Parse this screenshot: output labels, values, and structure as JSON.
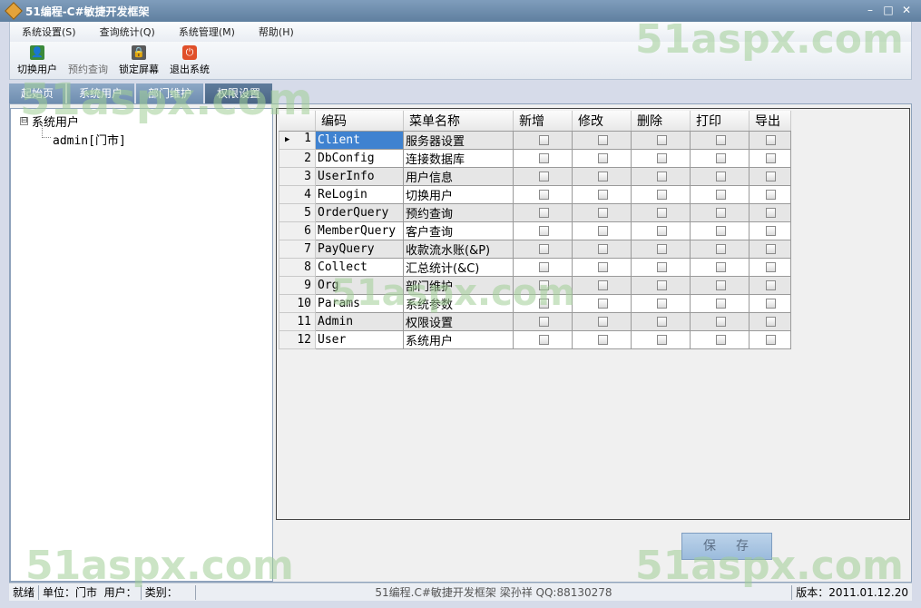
{
  "window": {
    "title": "51编程-C#敏捷开发框架"
  },
  "menu": [
    "系统设置(S)",
    "查询统计(Q)",
    "系统管理(M)",
    "帮助(H)"
  ],
  "toolbar": [
    {
      "label": "切换用户",
      "icon": "switch-user-icon",
      "enabled": true
    },
    {
      "label": "预约查询",
      "icon": "query-icon",
      "enabled": false
    },
    {
      "label": "锁定屏幕",
      "icon": "lock-icon",
      "enabled": true
    },
    {
      "label": "退出系统",
      "icon": "power-icon",
      "enabled": true
    }
  ],
  "tabs": [
    {
      "label": "起始页",
      "active": false
    },
    {
      "label": "系统用户",
      "active": false
    },
    {
      "label": "部门维护",
      "active": false
    },
    {
      "label": "权限设置",
      "active": true
    }
  ],
  "tree": {
    "root": "系统用户",
    "toggle": "⊟",
    "children": [
      "admin[门市]"
    ]
  },
  "grid": {
    "columns": [
      "编码",
      "菜单名称",
      "新增",
      "修改",
      "删除",
      "打印",
      "导出"
    ],
    "rows": [
      {
        "n": "1",
        "code": "Client",
        "name": "服务器设置"
      },
      {
        "n": "2",
        "code": "DbConfig",
        "name": "连接数据库"
      },
      {
        "n": "3",
        "code": "UserInfo",
        "name": "用户信息"
      },
      {
        "n": "4",
        "code": "ReLogin",
        "name": "切换用户"
      },
      {
        "n": "5",
        "code": "OrderQuery",
        "name": "预约查询"
      },
      {
        "n": "6",
        "code": "MemberQuery",
        "name": "客户查询"
      },
      {
        "n": "7",
        "code": "PayQuery",
        "name": "收款流水账(&P)"
      },
      {
        "n": "8",
        "code": "Collect",
        "name": "汇总统计(&C)"
      },
      {
        "n": "9",
        "code": "Org",
        "name": "部门维护"
      },
      {
        "n": "10",
        "code": "Params",
        "name": "系统参数"
      },
      {
        "n": "11",
        "code": "Admin",
        "name": "权限设置"
      },
      {
        "n": "12",
        "code": "User",
        "name": "系统用户"
      }
    ],
    "selected_row": "1"
  },
  "save_label": "保存",
  "status": {
    "ready": "就绪",
    "unit": "单位：门市",
    "user": "用户：",
    "category": "类别：",
    "center": "51编程.C#敏捷开发框架 梁孙祥 QQ:88130278",
    "version": "版本：2011.01.12.20"
  },
  "watermark": "51aspx.com",
  "colors": {
    "selection": "#3f82d0",
    "tab_active": "#4a6585",
    "watermark": "#a0cd96"
  }
}
